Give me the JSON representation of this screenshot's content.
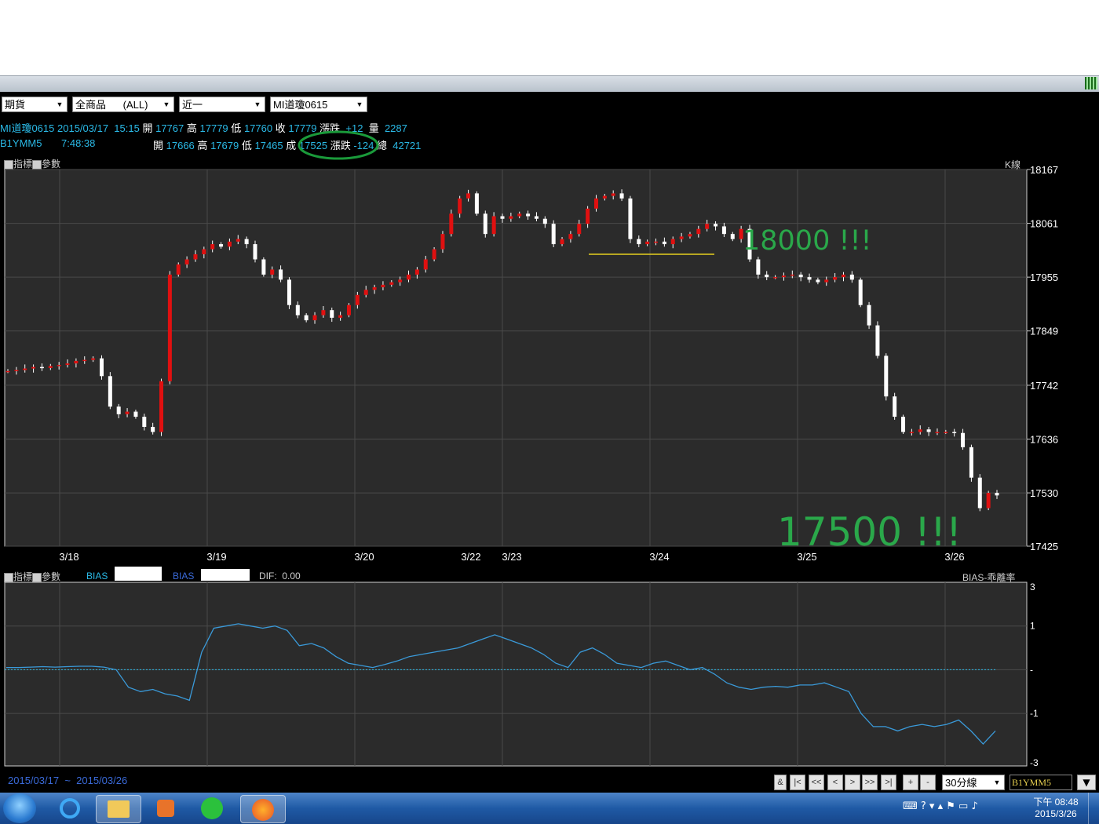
{
  "toolbar": {
    "market_select": "期貨",
    "product_select": "全商品      (ALL)",
    "range_select": "近一",
    "symbol_select": "MI道瓊0615"
  },
  "quote_line1": {
    "symbol": "MI道瓊0615",
    "datetime": "2015/03/17  15:15",
    "open_label": "開",
    "open": "17767",
    "high_label": "高",
    "high": "17779",
    "low_label": "低",
    "low": "17760",
    "close_label": "收",
    "close": "17779",
    "change_label": "漲跌",
    "change": "+12",
    "volume_label": "量",
    "volume": "2287"
  },
  "quote_line2": {
    "symbol": "B1YMM5",
    "time": "7:48:38",
    "open_label": "開",
    "open": "17666",
    "high_label": "高",
    "high": "17679",
    "low_label": "低",
    "low": "17465",
    "close_label": "成",
    "close": "17525",
    "change_label": "漲跌",
    "change": "-124",
    "total_label": "總",
    "total": "42721"
  },
  "main_panel": {
    "indicator_btn": "指標",
    "param_btn": "參數",
    "kline_label": "K線"
  },
  "sub_panel": {
    "indicator_btn": "指標",
    "param_btn": "參數",
    "bias1_label": "BIAS",
    "bias2_label": "BIAS",
    "dif_label": "DIF:",
    "dif_value": "0.00",
    "title": "BIAS-乖離率"
  },
  "annotations": {
    "note_high": "18000 !!!",
    "note_low": "17500 !!!"
  },
  "footer": {
    "date_from": "2015/03/17",
    "tilde": "~",
    "date_to": "2015/03/26",
    "nav": [
      "&",
      "|<",
      "<<",
      "<",
      ">",
      ">>",
      ">|",
      "+",
      "-"
    ],
    "period_select": "30分線",
    "symbol_input": "B1YMM5"
  },
  "taskbar": {
    "time": "下午 08:48",
    "date": "2015/3/26"
  },
  "colors": {
    "up": "#e01010",
    "down": "#ffffff",
    "bias_line": "#3a9ad9",
    "note": "#2aa84a",
    "axis_text": "#ffffff"
  },
  "chart_data": [
    {
      "type": "candlestick",
      "title": "",
      "ylim": [
        17425,
        18167
      ],
      "y_ticks": [
        18167,
        18061,
        17955,
        17849,
        17742,
        17636,
        17530,
        17425
      ],
      "x_ticks": [
        "3/18",
        "3/19",
        "3/20",
        "3/22",
        "3/23",
        "3/24",
        "3/25",
        "3/26"
      ],
      "close_path": [
        17770,
        17772,
        17775,
        17778,
        17776,
        17780,
        17782,
        17785,
        17790,
        17792,
        17795,
        17760,
        17700,
        17685,
        17690,
        17680,
        17660,
        17650,
        17750,
        17960,
        17980,
        17990,
        18000,
        18010,
        18020,
        18015,
        18025,
        18030,
        18020,
        17990,
        17960,
        17970,
        17950,
        17900,
        17880,
        17870,
        17880,
        17890,
        17875,
        17880,
        17900,
        17920,
        17930,
        17935,
        17940,
        17945,
        17950,
        17960,
        17970,
        17990,
        18010,
        18040,
        18080,
        18110,
        18120,
        18080,
        18040,
        18075,
        18070,
        18075,
        18080,
        18075,
        18070,
        18060,
        18020,
        18030,
        18040,
        18060,
        18090,
        18110,
        18115,
        18120,
        18110,
        18030,
        18020,
        18025,
        18025,
        18020,
        18030,
        18035,
        18040,
        18050,
        18060,
        18055,
        18040,
        18030,
        18050,
        17990,
        17960,
        17955,
        17955,
        17958,
        17960,
        17955,
        17950,
        17945,
        17950,
        17955,
        17960,
        17950,
        17900,
        17860,
        17800,
        17720,
        17680,
        17650,
        17650,
        17655,
        17650,
        17650,
        17650,
        17648,
        17620,
        17560,
        17500,
        17530,
        17525
      ]
    },
    {
      "type": "line",
      "title": "BIAS-乖離率",
      "ylim": [
        -3,
        3
      ],
      "y_ticks": [
        "3",
        "1",
        "-",
        "-1",
        "-3"
      ],
      "series": [
        {
          "name": "BIAS",
          "values": [
            0.05,
            0.05,
            0.06,
            0.07,
            0.06,
            0.07,
            0.08,
            0.08,
            0.06,
            0.0,
            -0.4,
            -0.5,
            -0.45,
            -0.55,
            -0.6,
            -0.7,
            0.4,
            0.95,
            1.0,
            1.05,
            1.0,
            0.95,
            1.0,
            0.9,
            0.55,
            0.6,
            0.5,
            0.3,
            0.15,
            0.1,
            0.05,
            0.12,
            0.2,
            0.3,
            0.35,
            0.4,
            0.45,
            0.5,
            0.6,
            0.7,
            0.8,
            0.7,
            0.6,
            0.5,
            0.35,
            0.15,
            0.05,
            0.4,
            0.5,
            0.35,
            0.15,
            0.1,
            0.05,
            0.15,
            0.2,
            0.1,
            0.0,
            0.05,
            -0.1,
            -0.3,
            -0.4,
            -0.45,
            -0.4,
            -0.38,
            -0.4,
            -0.35,
            -0.35,
            -0.3,
            -0.4,
            -0.5,
            -1.0,
            -1.3,
            -1.3,
            -1.4,
            -1.3,
            -1.25,
            -1.3,
            -1.25,
            -1.15,
            -1.4,
            -1.7,
            -1.4
          ]
        }
      ]
    }
  ]
}
